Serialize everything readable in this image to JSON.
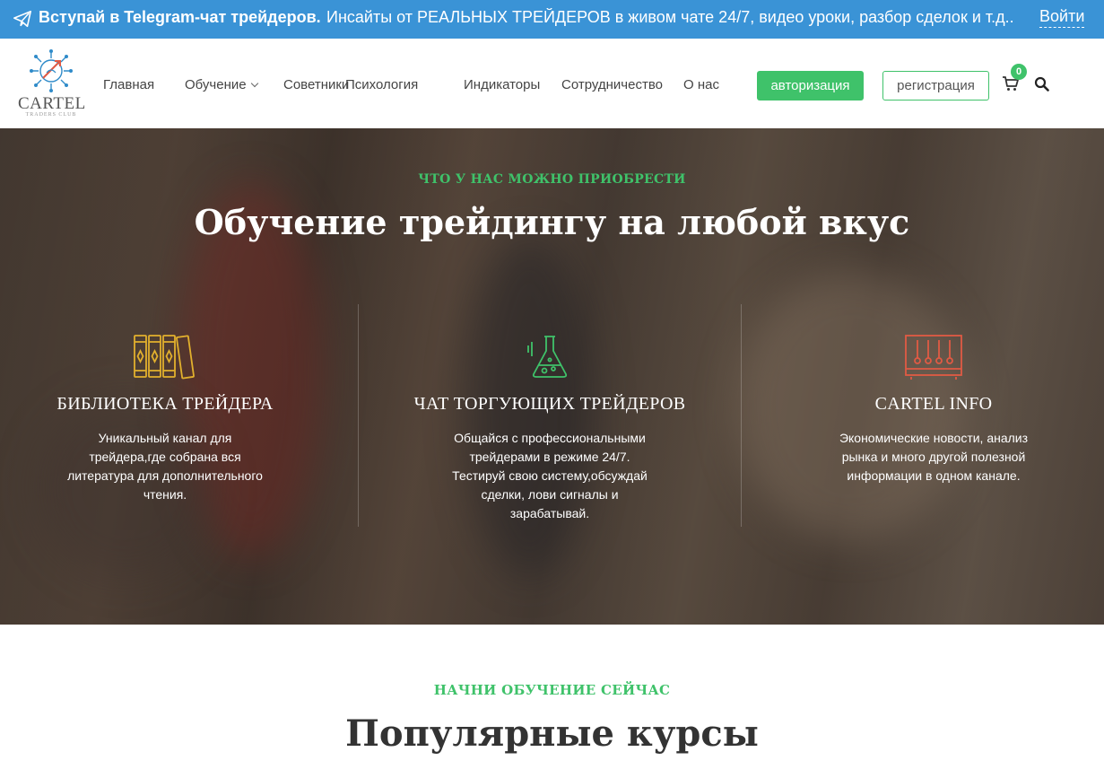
{
  "colors": {
    "telegram_bar": "#3a93d6",
    "accent_green": "#3fc26a",
    "icon_gold": "#e2b02d",
    "icon_red": "#e05a44"
  },
  "topbar": {
    "icon": "paper-plane-icon",
    "headline": "Вступай в Telegram-чат трейдеров.",
    "text": "Инсайты от РЕАЛЬНЫХ ТРЕЙДЕРОВ в живом чате 24/7, видео уроки, разбор сделок и т.д..",
    "login": "Войти"
  },
  "header": {
    "logo_text": "CARTEL",
    "logo_subtext": "TRADERS CLUB",
    "nav": [
      "Главная",
      "Обучение",
      "Советники",
      "Психология",
      "Индикаторы",
      "Сотрудничество",
      "О нас"
    ],
    "login_button": "авторизация",
    "register_button": "регистрация",
    "cart_icon": "cart-icon",
    "cart_count": "0",
    "search_icon": "search-icon"
  },
  "hero": {
    "eyebrow": "ЧТО У НАС МОЖНО ПРИОБРЕСТИ",
    "title": "Обучение трейдингу на любой вкус",
    "features": [
      {
        "icon": "books-icon",
        "title": "БИБЛИОТЕКА ТРЕЙДЕРА",
        "description": "Уникальный канал для трейдера,где собрана вся литература для дополнительного чтения."
      },
      {
        "icon": "flask-icon",
        "title": "ЧАТ ТОРГУЮЩИХ ТРЕЙДЕРОВ",
        "description": "Общайся с профессиональными трейдерами в режиме 24/7. Тестируй свою систему,обсуждай сделки, лови сигналы и зарабатывай."
      },
      {
        "icon": "newtons-cradle-icon",
        "title": "CARTEL INFO",
        "description": "Экономические новости, анализ рынка и много другой полезной информации в одном канале."
      }
    ]
  },
  "courses": {
    "eyebrow": "НАЧНИ ОБУЧЕНИЕ СЕЙЧАС",
    "title": "Популярные курсы"
  }
}
